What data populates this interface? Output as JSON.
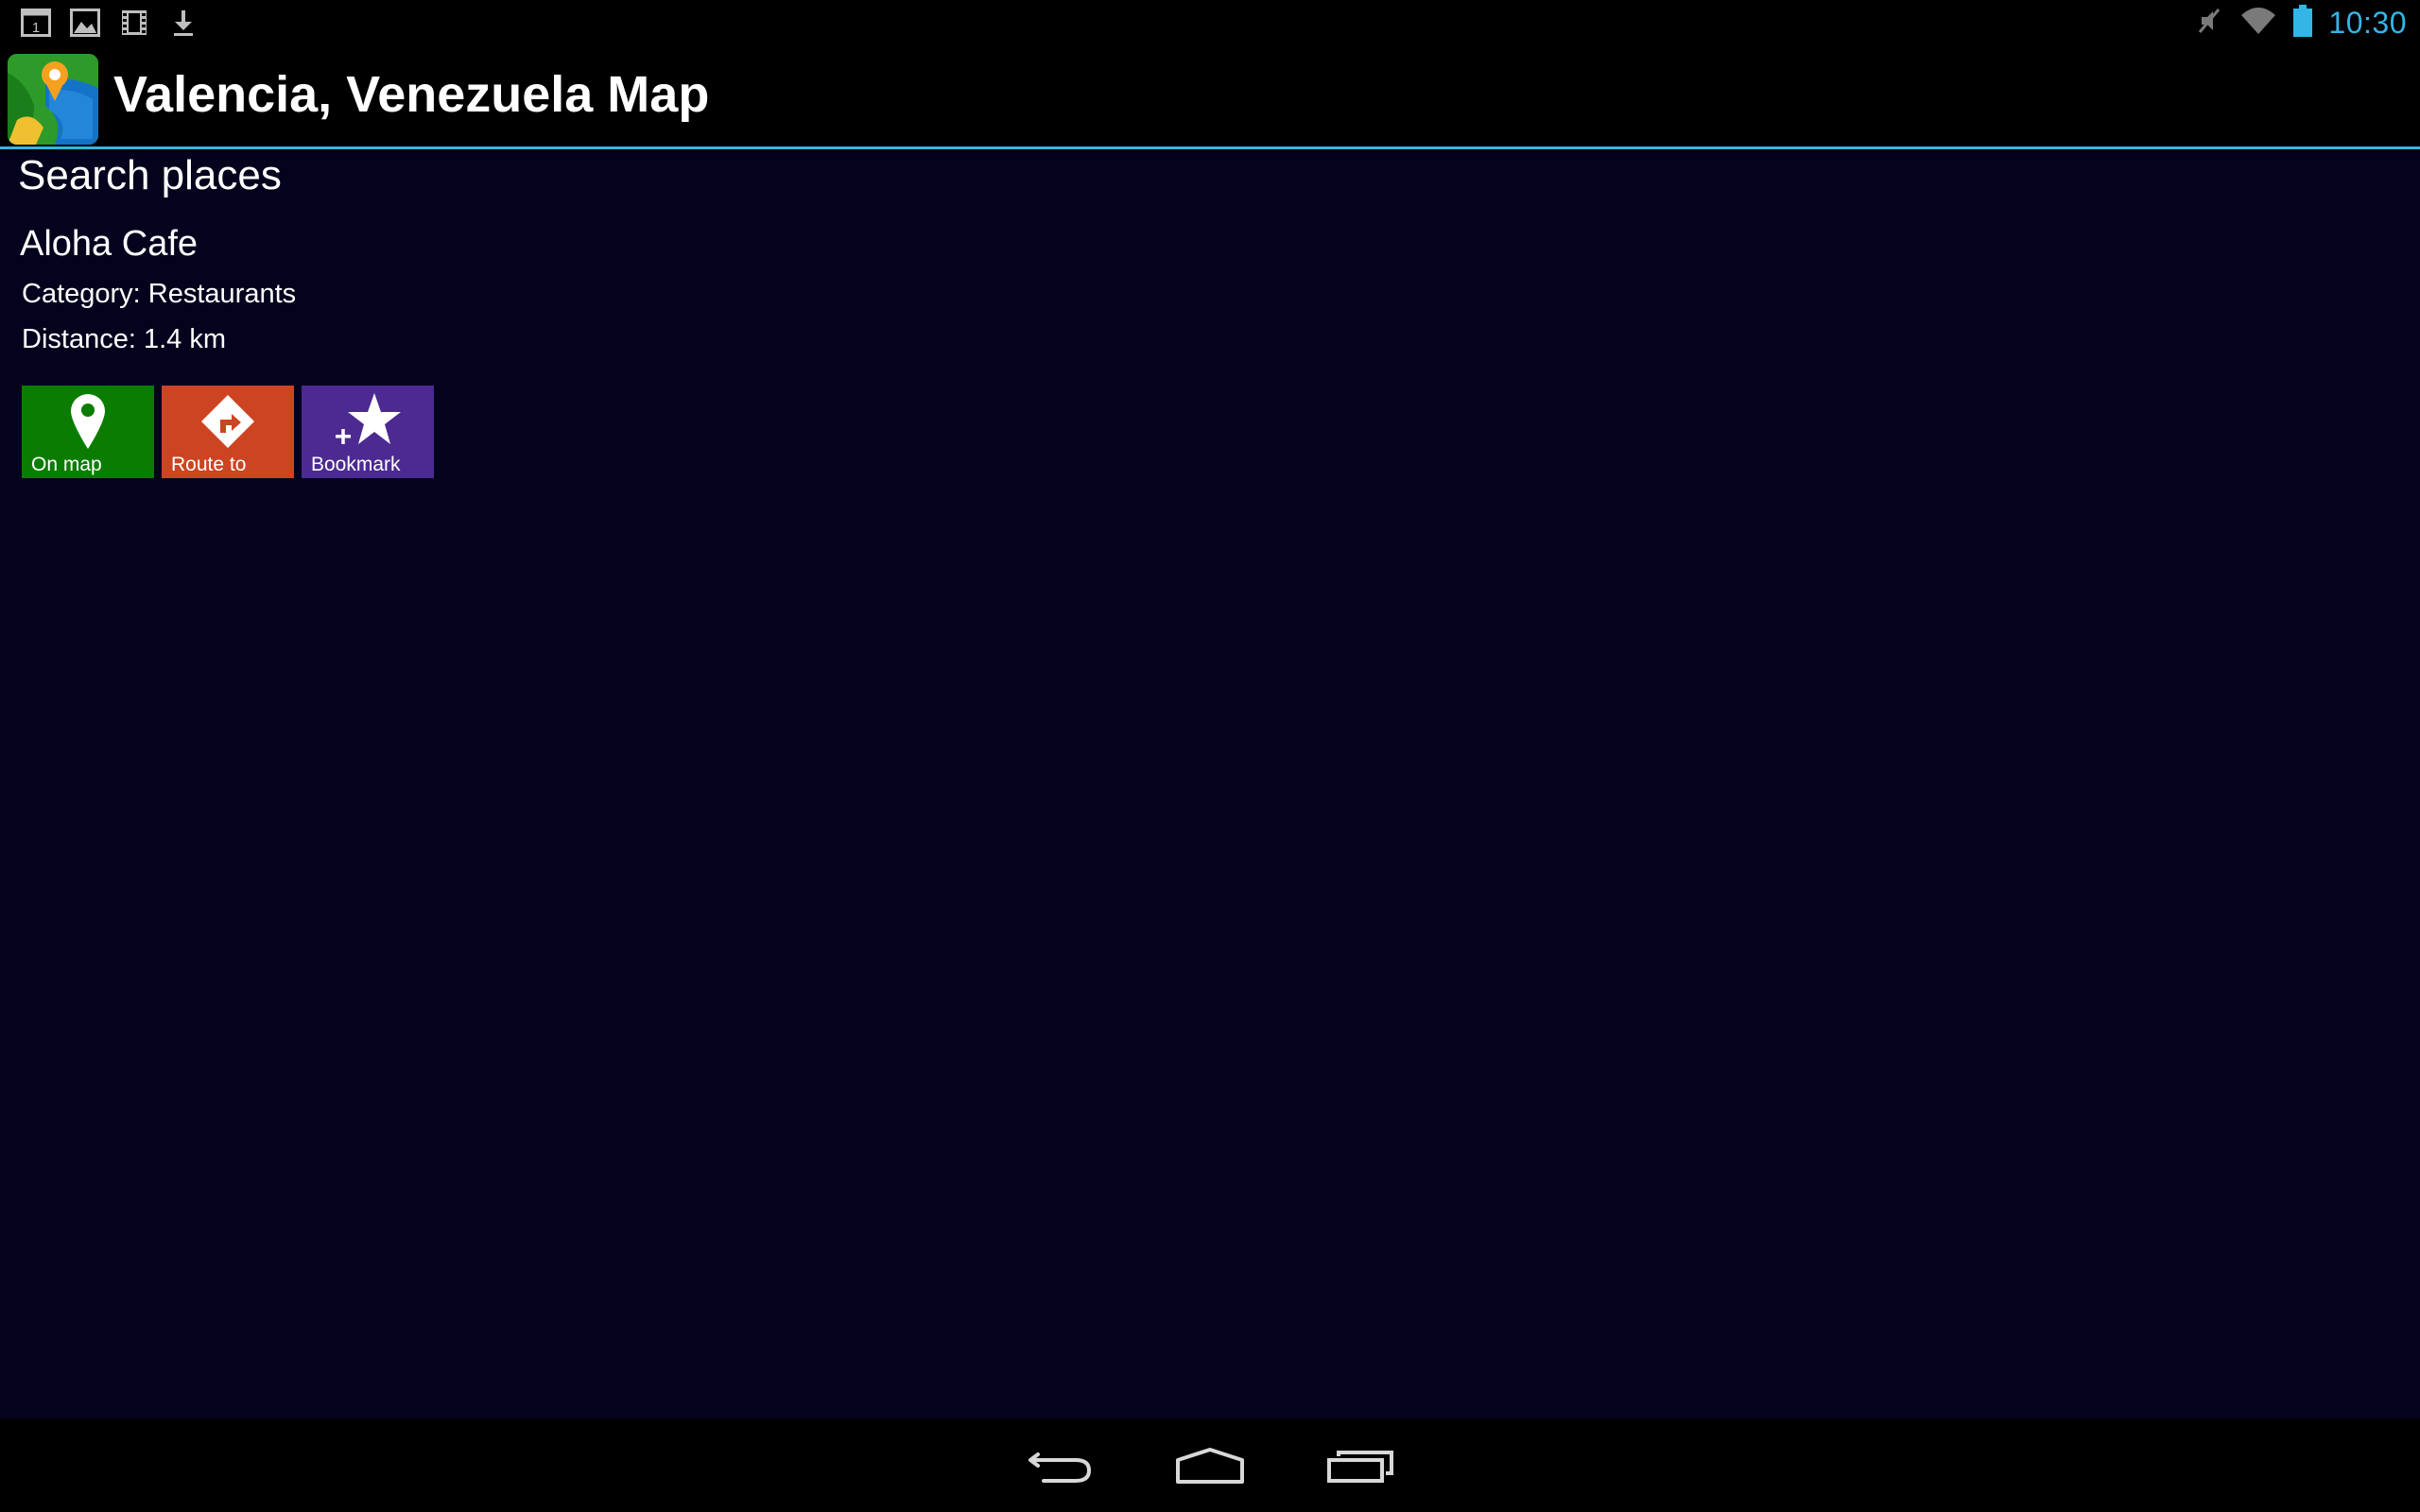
{
  "status_bar": {
    "time": "10:30",
    "notification_icons": [
      "calendar-icon",
      "picture-icon",
      "film-icon",
      "download-icon"
    ],
    "system_icons": [
      "mute-icon",
      "wifi-icon",
      "battery-icon"
    ],
    "calendar_day": "1"
  },
  "action_bar": {
    "title": "Valencia, Venezuela Map",
    "accent_color": "#33b5e5"
  },
  "content": {
    "section_title": "Search places",
    "place": {
      "name": "Aloha Cafe",
      "category": "Category: Restaurants",
      "distance": "Distance: 1.4 km"
    },
    "actions": [
      {
        "label": "On map",
        "icon": "map-pin-icon",
        "color": "#0a7d00"
      },
      {
        "label": "Route to",
        "icon": "route-sign-icon",
        "color": "#cc4422"
      },
      {
        "label": "Bookmark",
        "icon": "bookmark-star-icon",
        "color": "#4c2a92"
      }
    ]
  },
  "nav_bar": {
    "buttons": [
      "back-icon",
      "home-icon",
      "recent-apps-icon"
    ]
  },
  "colors": {
    "background": "#05021e",
    "bars": "#000000"
  }
}
